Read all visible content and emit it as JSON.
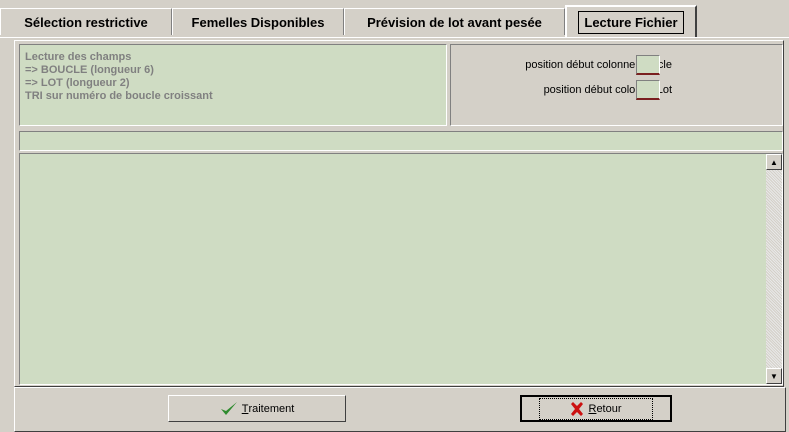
{
  "tabs": [
    {
      "label": "Sélection restrictive"
    },
    {
      "label": "Femelles Disponibles"
    },
    {
      "label": "Prévision de lot avant pesée"
    },
    {
      "label": "Lecture Fichier"
    }
  ],
  "info": {
    "lines": [
      "Lecture des champs",
      "=> BOUCLE (longueur 6)",
      "=> LOT (longueur 2)",
      "TRI sur numéro de boucle croissant"
    ]
  },
  "positions": {
    "boucle_label": "position début colonne Boucle",
    "boucle_value": "",
    "lot_label": "position début colonne Lot",
    "lot_value": ""
  },
  "strip_text": "",
  "memo_text": "",
  "buttons": {
    "traitement_first": "T",
    "traitement_rest": "raitement",
    "retour_first": "R",
    "retour_rest": "etour"
  },
  "colors": {
    "field_green": "#cfdcc3",
    "text_grey": "#808080",
    "check_green": "#2e8b2e",
    "cross_red": "#cc1111"
  }
}
